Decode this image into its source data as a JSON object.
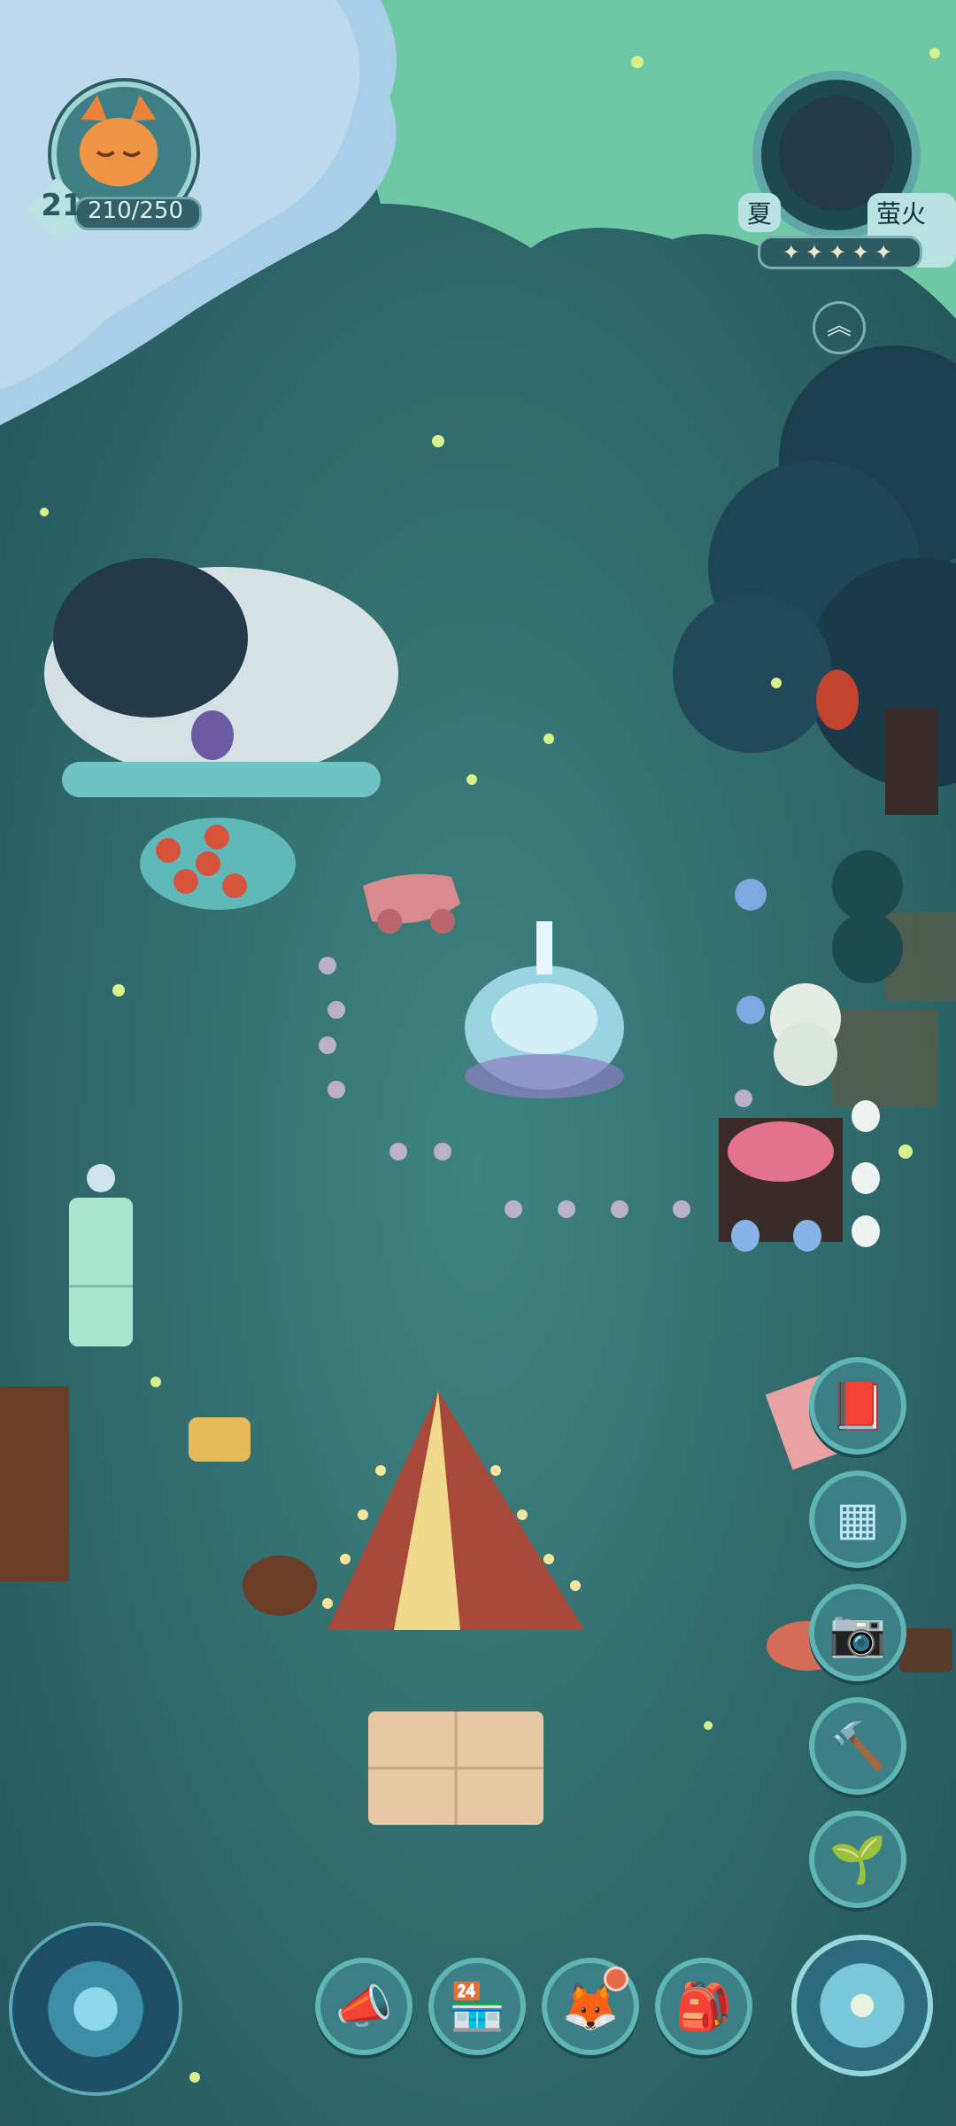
{
  "player": {
    "level": "21",
    "energy": "210/250",
    "avatar_icon": "orange-fox-avatar"
  },
  "time": {
    "season": "夏",
    "event": "萤火夜",
    "stars_text": "✦✦✦✦✦",
    "expand_icon": "double-chevron-up-icon"
  },
  "side_buttons": [
    {
      "name": "album-book-button",
      "glyph": "📕"
    },
    {
      "name": "furniture-layout-button",
      "glyph": "▦"
    },
    {
      "name": "camera-button",
      "glyph": "📷"
    },
    {
      "name": "hammer-build-button",
      "glyph": "🔨"
    },
    {
      "name": "sprout-planting-button",
      "glyph": "🌱"
    }
  ],
  "bottom_buttons": [
    {
      "name": "announcement-megaphone-button",
      "glyph": "📣"
    },
    {
      "name": "shop-button",
      "glyph": "🏪"
    },
    {
      "name": "character-fox-button",
      "glyph": "🦊",
      "notification": true
    },
    {
      "name": "backpack-button",
      "glyph": "🎒"
    }
  ],
  "colors": {
    "background": "#2f6a6a",
    "button_fill": "#3c7f87",
    "button_ring": "#5fb5b3",
    "notification": "#e66b4c"
  }
}
